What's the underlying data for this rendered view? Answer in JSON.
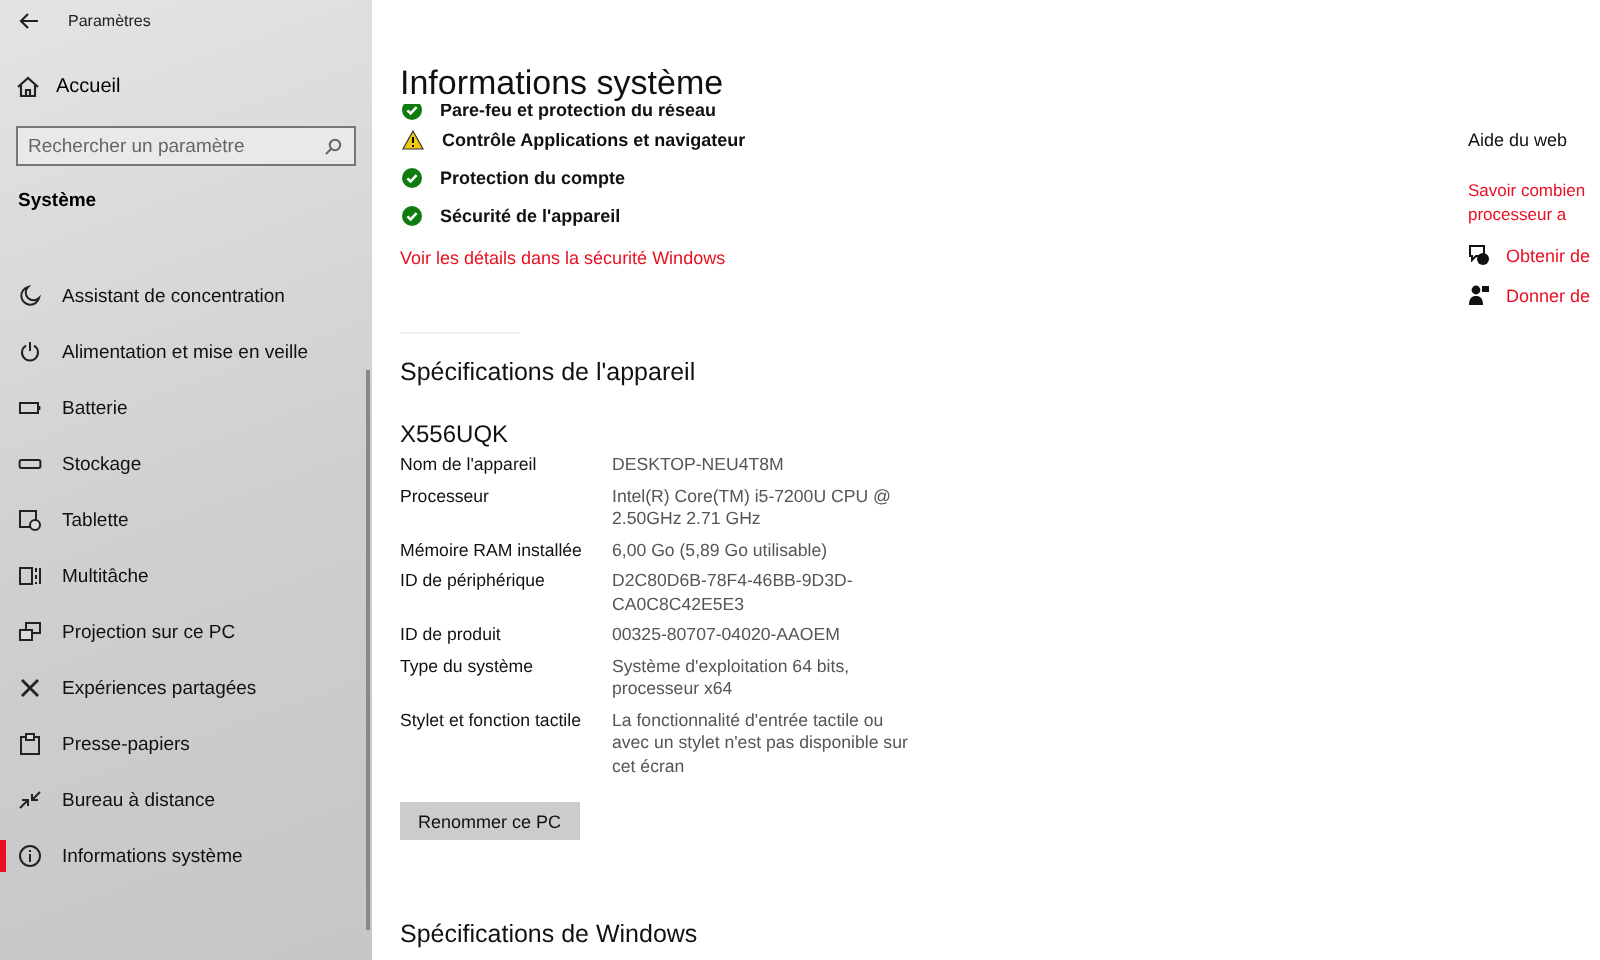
{
  "window": {
    "title": "Paramètres"
  },
  "sidebar": {
    "home": "Accueil",
    "search": {
      "placeholder": "Rechercher un paramètre"
    },
    "section": "Système",
    "items": [
      {
        "label": "Assistant de concentration",
        "selected": false
      },
      {
        "label": "Alimentation et mise en veille",
        "selected": false
      },
      {
        "label": "Batterie",
        "selected": false
      },
      {
        "label": "Stockage",
        "selected": false
      },
      {
        "label": "Tablette",
        "selected": false
      },
      {
        "label": "Multitâche",
        "selected": false
      },
      {
        "label": "Projection sur ce PC",
        "selected": false
      },
      {
        "label": "Expériences partagées",
        "selected": false
      },
      {
        "label": "Presse-papiers",
        "selected": false
      },
      {
        "label": "Bureau à distance",
        "selected": false
      },
      {
        "label": "Informations système",
        "selected": true
      }
    ]
  },
  "page_title": "Informations système",
  "security": [
    {
      "label": "Pare-feu et protection du réseau",
      "kind": "ok"
    },
    {
      "label": "Contrôle Applications et navigateur",
      "kind": "warning"
    },
    {
      "label": "Protection du compte",
      "kind": "ok"
    },
    {
      "label": "Sécurité de l'appareil",
      "kind": "ok"
    }
  ],
  "security_link": "Voir les détails dans la sécurité Windows",
  "device_specs": {
    "heading": "Spécifications de l'appareil",
    "model": "X556UQK",
    "rows": [
      {
        "label": "Nom de l'appareil",
        "value": "DESKTOP-NEU4T8M"
      },
      {
        "label": "Processeur",
        "value": "Intel(R) Core(TM) i5-7200U CPU @ 2.50GHz   2.71 GHz"
      },
      {
        "label": "Mémoire RAM installée",
        "value": "6,00 Go (5,89 Go utilisable)"
      },
      {
        "label": "ID de périphérique",
        "value": "D2C80D6B-78F4-46BB-9D3D-CA0C8C42E5E3"
      },
      {
        "label": "ID de produit",
        "value": "00325-80707-04020-AAOEM"
      },
      {
        "label": "Type du système",
        "value": "Système d'exploitation 64 bits, processeur x64"
      },
      {
        "label": "Stylet et fonction tactile",
        "value": "La fonctionnalité d'entrée tactile ou avec un stylet n'est pas disponible sur cet écran"
      }
    ],
    "button": "Renommer ce PC"
  },
  "windows_specs": {
    "heading": "Spécifications de Windows"
  },
  "web_help": {
    "heading": "Aide du web",
    "link": "Savoir combien processeur a",
    "actions": [
      {
        "label": "Obtenir de"
      },
      {
        "label": "Donner de"
      }
    ]
  }
}
